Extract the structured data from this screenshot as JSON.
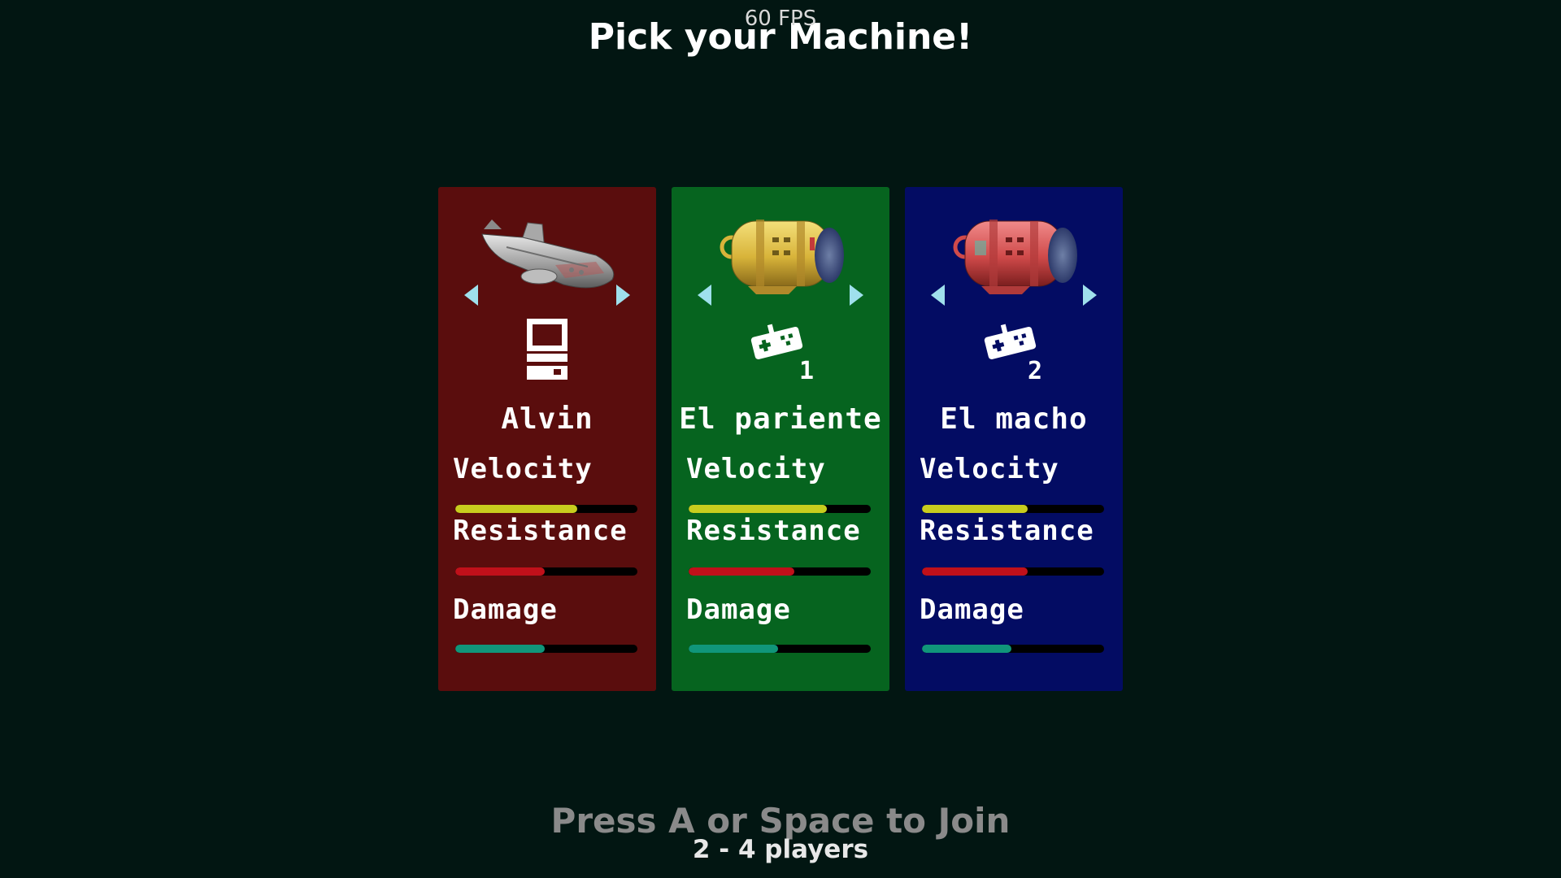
{
  "hud": {
    "fps": "60 FPS"
  },
  "header": {
    "title": "Pick your Machine!"
  },
  "stat_labels": {
    "velocity": "Velocity",
    "resistance": "Resistance",
    "damage": "Damage"
  },
  "colors": {
    "background": "#021612",
    "velocity_bar": "#c8cd1e",
    "resistance_bar": "#c0101a",
    "damage_bar": "#10967a",
    "arrow": "#9fe0ec"
  },
  "cards": [
    {
      "name": "Alvin",
      "background": "#5a0d0d",
      "machine_icon": "submarine-icon",
      "controller_icon": "computer-icon",
      "controller_number": "",
      "stats": {
        "velocity": 0.67,
        "resistance": 0.49,
        "damage": 0.49
      }
    },
    {
      "name": "El pariente",
      "background": "#06641f",
      "machine_icon": "yellow-capsule-icon",
      "controller_icon": "gamepad-icon",
      "controller_number": "1",
      "stats": {
        "velocity": 0.76,
        "resistance": 0.58,
        "damage": 0.49
      }
    },
    {
      "name": "El macho",
      "background": "#030c63",
      "machine_icon": "red-capsule-icon",
      "controller_icon": "gamepad-icon",
      "controller_number": "2",
      "stats": {
        "velocity": 0.58,
        "resistance": 0.58,
        "damage": 0.49
      }
    }
  ],
  "footer": {
    "join_prompt": "Press A or Space to Join",
    "players": "2 - 4 players"
  }
}
